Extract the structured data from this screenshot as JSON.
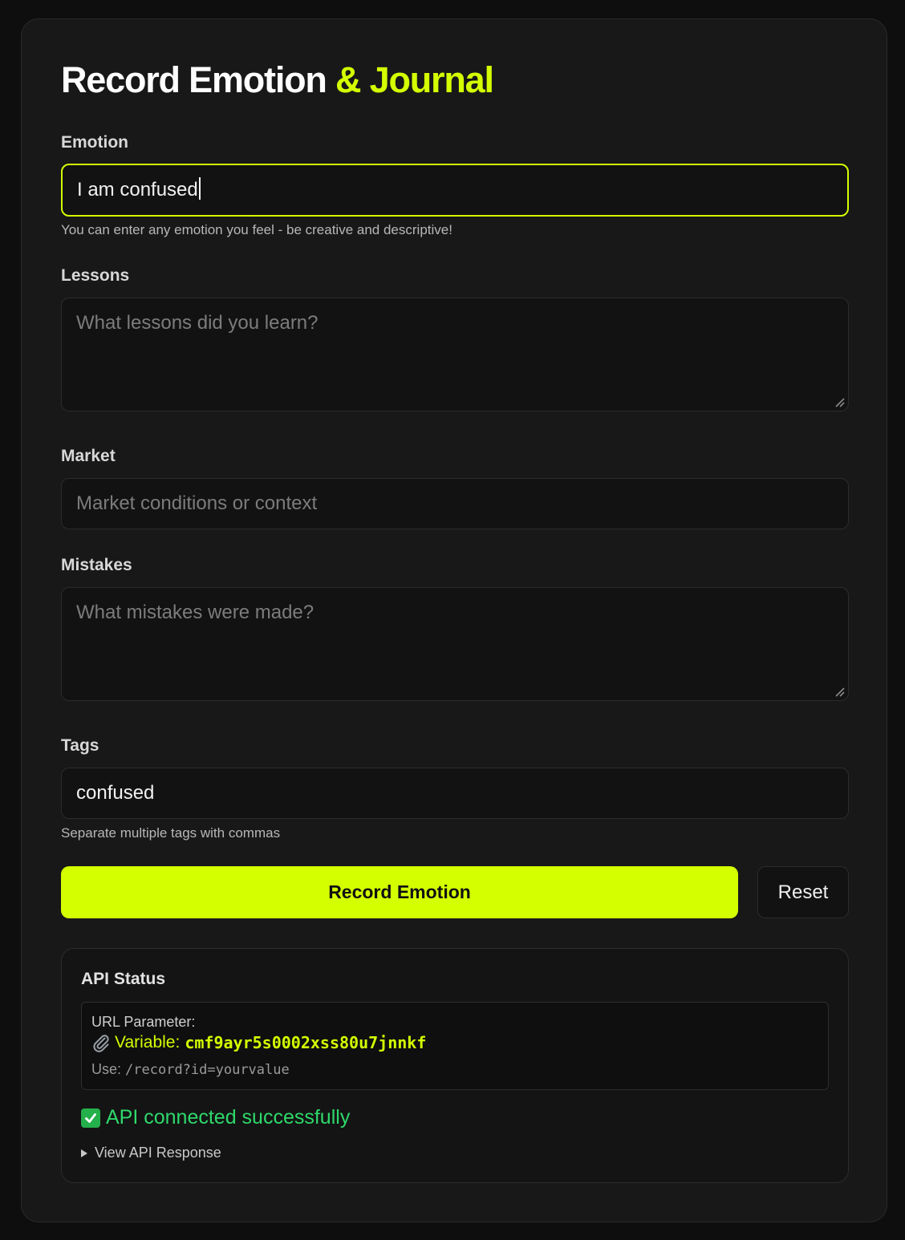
{
  "header": {
    "title_main": "Record Emotion",
    "title_accent": "& Journal"
  },
  "form": {
    "emotion": {
      "label": "Emotion",
      "value": "I am confused",
      "hint": "You can enter any emotion you feel - be creative and descriptive!"
    },
    "lessons": {
      "label": "Lessons",
      "placeholder": "What lessons did you learn?"
    },
    "market": {
      "label": "Market",
      "placeholder": "Market conditions or context"
    },
    "mistakes": {
      "label": "Mistakes",
      "placeholder": "What mistakes were made?"
    },
    "tags": {
      "label": "Tags",
      "value": "confused",
      "hint": "Separate multiple tags with commas"
    }
  },
  "actions": {
    "submit_label": "Record Emotion",
    "reset_label": "Reset"
  },
  "api_status": {
    "title": "API Status",
    "param_label": "URL Parameter:",
    "variable_label": "Variable:",
    "variable_value": "cmf9ayr5s0002xss80u7jnnkf",
    "use_label": "Use:",
    "use_value": "/record?id=yourvalue",
    "status_message": "API connected successfully",
    "details_label": "View API Response"
  },
  "colors": {
    "accent": "#d4ff00",
    "success": "#2ed96a",
    "background": "#0e0e0e",
    "card": "#181818"
  },
  "icons": {
    "variable": "paperclip-icon",
    "status": "check-mark-button-icon",
    "details": "triangle-right-icon",
    "resize": "resize-grip-icon"
  }
}
